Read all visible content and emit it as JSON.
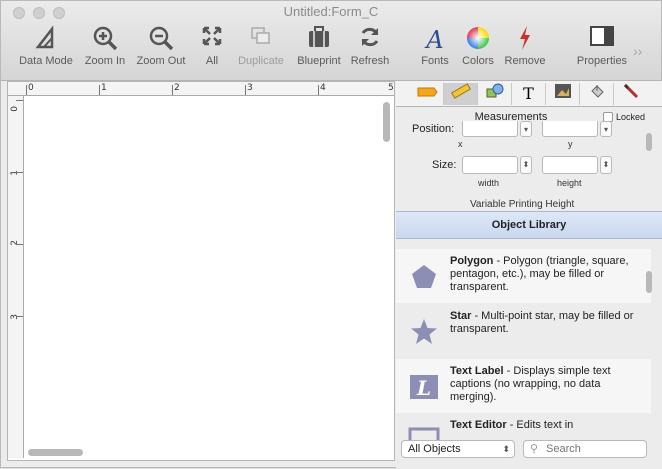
{
  "window": {
    "title": "Untitled:Form_C"
  },
  "toolbar": {
    "data_mode": "Data Mode",
    "zoom_in": "Zoom In",
    "zoom_out": "Zoom Out",
    "all": "All",
    "duplicate": "Duplicate",
    "blueprint": "Blueprint",
    "refresh": "Refresh",
    "fonts": "Fonts",
    "colors": "Colors",
    "remove": "Remove",
    "properties": "Properties",
    "more": "››"
  },
  "ruler": {
    "top_numbers": [
      "0",
      "1",
      "2",
      "3",
      "4",
      "5"
    ],
    "left_numbers": [
      "0",
      "1",
      "2",
      "3"
    ]
  },
  "panel": {
    "measurements_title": "Measurements",
    "locked_label": "Locked",
    "position_label": "Position:",
    "x_label": "x",
    "y_label": "y",
    "size_label": "Size:",
    "width_label": "width",
    "height_label": "height",
    "variable_printing_height": "Variable Printing Height",
    "library_title": "Object Library",
    "library_items": [
      {
        "name": "Polygon",
        "desc": " - Polygon (triangle, square, pentagon, etc.), may be filled or transparent."
      },
      {
        "name": "Star",
        "desc": " - Multi-point star, may be filled or transparent."
      },
      {
        "name": "Text Label",
        "desc": " - Displays simple text captions (no wrapping, no data merging)."
      },
      {
        "name": "Text Editor",
        "desc": " - Edits text in"
      }
    ],
    "filter_select": "All Objects",
    "search_placeholder": "Search"
  },
  "colors": {
    "accent_shape": "#8c8fb3",
    "library_header": "#c9d8ef"
  }
}
